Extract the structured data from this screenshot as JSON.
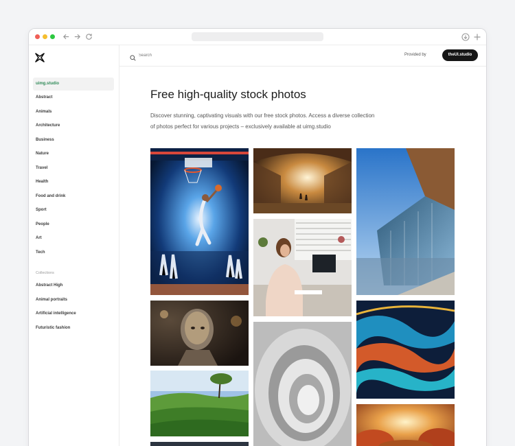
{
  "toolbar": {
    "back_icon": "arrow-left-icon",
    "forward_icon": "arrow-right-icon",
    "reload_icon": "refresh-icon",
    "download_icon": "download-icon",
    "new_tab_icon": "plus-icon"
  },
  "sidebar": {
    "logo_icon": "uimg-logo-icon",
    "categories": [
      {
        "label": "uimg.studio",
        "active": true
      },
      {
        "label": "Abstract"
      },
      {
        "label": "Animals"
      },
      {
        "label": "Architecture"
      },
      {
        "label": "Business"
      },
      {
        "label": "Nature"
      },
      {
        "label": "Travel"
      },
      {
        "label": "Health"
      },
      {
        "label": "Food and drink"
      },
      {
        "label": "Sport"
      },
      {
        "label": "People"
      },
      {
        "label": "Art"
      },
      {
        "label": "Tech"
      }
    ],
    "collections_heading": "Collections",
    "collections": [
      {
        "label": "Abstract High"
      },
      {
        "label": "Animal portraits"
      },
      {
        "label": "Artificial intelligence"
      },
      {
        "label": "Futuristic fashion"
      }
    ]
  },
  "topbar": {
    "search_placeholder": "Search",
    "provided_by": "Provided by",
    "brand_button": "theUI.studio"
  },
  "main": {
    "title": "Free high-quality stock photos",
    "description": "Discover stunning, captivating visuals with our free stock photos. Access a diverse collection of photos perfect for various projects – exclusively available at uimg.studio"
  },
  "colors": {
    "active_green": "#2f8a57",
    "brand_button_bg": "#161616"
  }
}
